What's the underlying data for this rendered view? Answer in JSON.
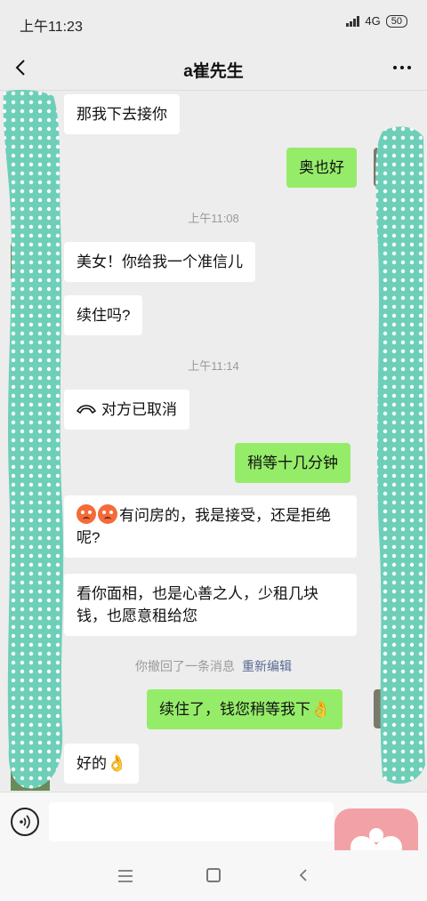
{
  "status": {
    "time": "上午11:23",
    "network": "4G",
    "battery": "50"
  },
  "header": {
    "title": "a崔先生"
  },
  "messages": {
    "m1": "那我下去接你",
    "m2": "奥也好",
    "ts1": "上午11:08",
    "m3": "美女！你给我一个准信儿",
    "m4": "续住吗?",
    "ts2": "上午11:14",
    "m5": "对方已取消",
    "m6": "稍等十几分钟",
    "m7_text": "有问房的，我是接受，还是拒绝呢?",
    "m8": "看你面相，也是心善之人，少租几块钱，也愿意租给您",
    "recall_text": "你撤回了一条消息",
    "recall_action": "重新编辑",
    "m9": "续住了，钱您稍等我下",
    "m10": "好的"
  },
  "icons": {
    "back": "chevron-left-icon",
    "more": "more-dots-icon",
    "call": "phone-hangup-icon",
    "voice": "voice-icon",
    "heart": "heart-app-icon"
  },
  "colors": {
    "left_bubble": "#ffffff",
    "right_bubble": "#95ec69",
    "link": "#576b95",
    "scribble": "#6ecfb8"
  }
}
